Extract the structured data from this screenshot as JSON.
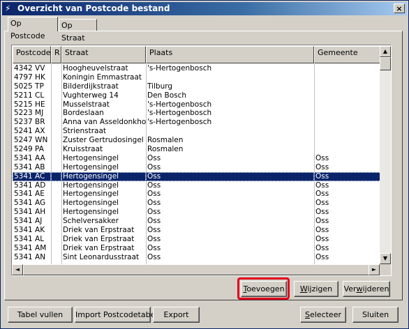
{
  "window": {
    "title": "Overzicht van Postcode bestand",
    "close_label": "×"
  },
  "tabs": [
    {
      "label": "Op Postcode",
      "active": true
    },
    {
      "label": "Op Straat",
      "active": false
    }
  ],
  "grid": {
    "columns": [
      "Postcode",
      "R",
      "Straat",
      "Plaats",
      "Gemeente"
    ],
    "selected_row": 12,
    "rows": [
      [
        "4342 VV",
        "",
        "Hoogheuvelstraat",
        "'s-Hertogenbosch",
        ""
      ],
      [
        "4797 HK",
        "",
        "Koningin Emmastraat",
        "",
        ""
      ],
      [
        "5025 TP",
        "",
        "Bilderdijkstraat",
        "Tilburg",
        ""
      ],
      [
        "5211 CL",
        "",
        "Vughterweg 14",
        "Den Bosch",
        ""
      ],
      [
        "5215 HE",
        "",
        "Musselstraat",
        "'s-Hertogenbosch",
        ""
      ],
      [
        "5223 MJ",
        "",
        "Bordeslaan",
        "'s-Hertogenbosch",
        ""
      ],
      [
        "5237 BR",
        "",
        "Anna van Asseldonkhof",
        "'s-Hertogenbosch",
        ""
      ],
      [
        "5241 AX",
        "",
        "Strienstraat",
        "",
        ""
      ],
      [
        "5247 WN",
        "",
        "Zuster Gertrudosingel",
        "Rosmalen",
        ""
      ],
      [
        "5249 PA",
        "",
        "Kruisstraat",
        "Rosmalen",
        ""
      ],
      [
        "5341 AA",
        "",
        "Hertogensingel",
        "Oss",
        "Oss"
      ],
      [
        "5341 AB",
        "",
        "Hertogensingel",
        "Oss",
        "Oss"
      ],
      [
        "5341 AC",
        "",
        "Hertogensingel",
        "Oss",
        "Oss"
      ],
      [
        "5341 AD",
        "",
        "Hertogensingel",
        "Oss",
        "Oss"
      ],
      [
        "5341 AE",
        "",
        "Hertogensingel",
        "Oss",
        "Oss"
      ],
      [
        "5341 AG",
        "",
        "Hertogensingel",
        "Oss",
        "Oss"
      ],
      [
        "5341 AH",
        "",
        "Hertogensingel",
        "Oss",
        "Oss"
      ],
      [
        "5341 AJ",
        "",
        "Schelversakker",
        "Oss",
        "Oss"
      ],
      [
        "5341 AK",
        "",
        "Driek van Erpstraat",
        "Oss",
        "Oss"
      ],
      [
        "5341 AL",
        "",
        "Driek van Erpstraat",
        "Oss",
        "Oss"
      ],
      [
        "5341 AM",
        "",
        "Driek van Erpstraat",
        "Oss",
        "Oss"
      ],
      [
        "5341 AN",
        "",
        "Sint Leonardusstraat",
        "Oss",
        "Oss"
      ]
    ]
  },
  "scrollbars": {
    "up_icon": "▲",
    "down_icon": "▼",
    "left_icon": "◄",
    "right_icon": "►"
  },
  "action_buttons": {
    "toevoegen": {
      "accel": "T",
      "rest": "oevoegen"
    },
    "wijzigen": {
      "accel": "W",
      "rest": "ijzigen"
    },
    "verwijderen": {
      "pre": "Ver",
      "accel": "w",
      "rest": "ijderen"
    }
  },
  "bottom_buttons": {
    "tabel_vullen": "Tabel vullen",
    "import": "Import Postcodetabel",
    "export": "Export",
    "selecteer": {
      "accel": "S",
      "rest": "electeer"
    },
    "sluiten": "Sluiten"
  },
  "colors": {
    "highlight": "#e0001a",
    "selection": "#0a246a",
    "title_bar": "#0a246a"
  }
}
